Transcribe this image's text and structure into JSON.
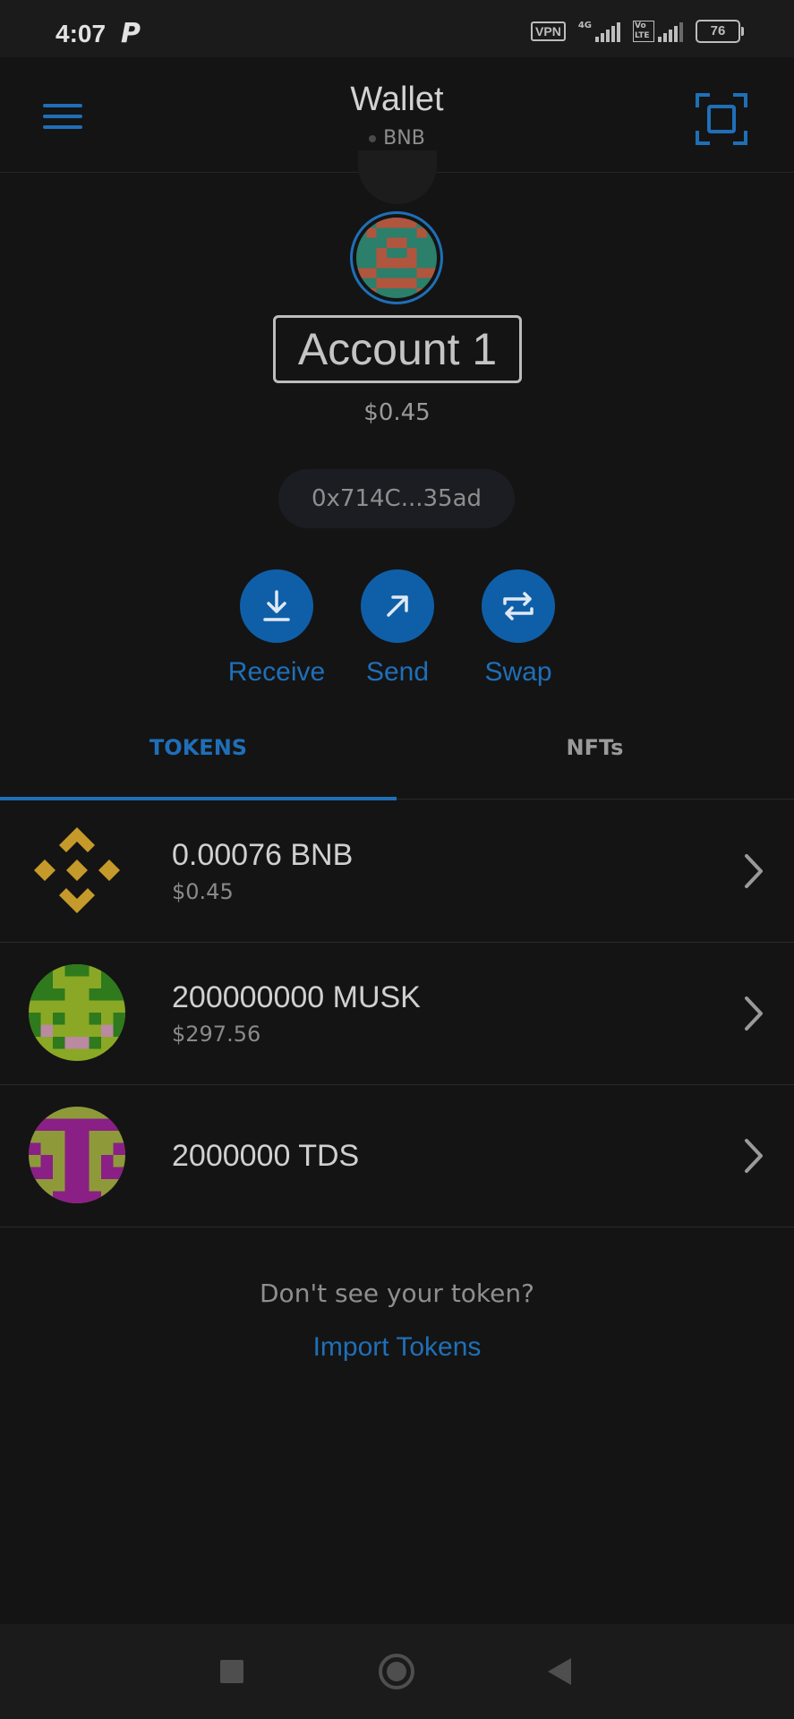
{
  "status_bar": {
    "time": "4:07",
    "p_icon": "P",
    "vpn": "VPN",
    "net1_label": "4G",
    "net2_label": "Vo LTE",
    "battery": "76"
  },
  "header": {
    "title": "Wallet",
    "network": "BNB",
    "menu_icon": "hamburger-icon",
    "scan_icon": "qr-scan-icon"
  },
  "account": {
    "name": "Account 1",
    "balance": "$0.45",
    "address": "0x714C...35ad"
  },
  "actions": [
    {
      "label": "Receive",
      "icon": "download-icon"
    },
    {
      "label": "Send",
      "icon": "arrow-up-right-icon"
    },
    {
      "label": "Swap",
      "icon": "swap-icon"
    }
  ],
  "tabs": {
    "tokens": "TOKENS",
    "nfts": "NFTs",
    "active": "TOKENS"
  },
  "tokens": [
    {
      "amount": "0.00076 BNB",
      "fiat": "$0.45",
      "icon": "bnb-logo-icon"
    },
    {
      "amount": "200000000 MUSK",
      "fiat": "$297.56",
      "icon": "musk-token-icon"
    },
    {
      "amount": "2000000 TDS",
      "fiat": "",
      "icon": "tds-token-icon"
    }
  ],
  "footer": {
    "prompt": "Don't see your token?",
    "import_link": "Import Tokens"
  },
  "colors": {
    "accent": "#1f6fb8",
    "background": "#141414",
    "bnb_gold": "#c59a2a"
  }
}
